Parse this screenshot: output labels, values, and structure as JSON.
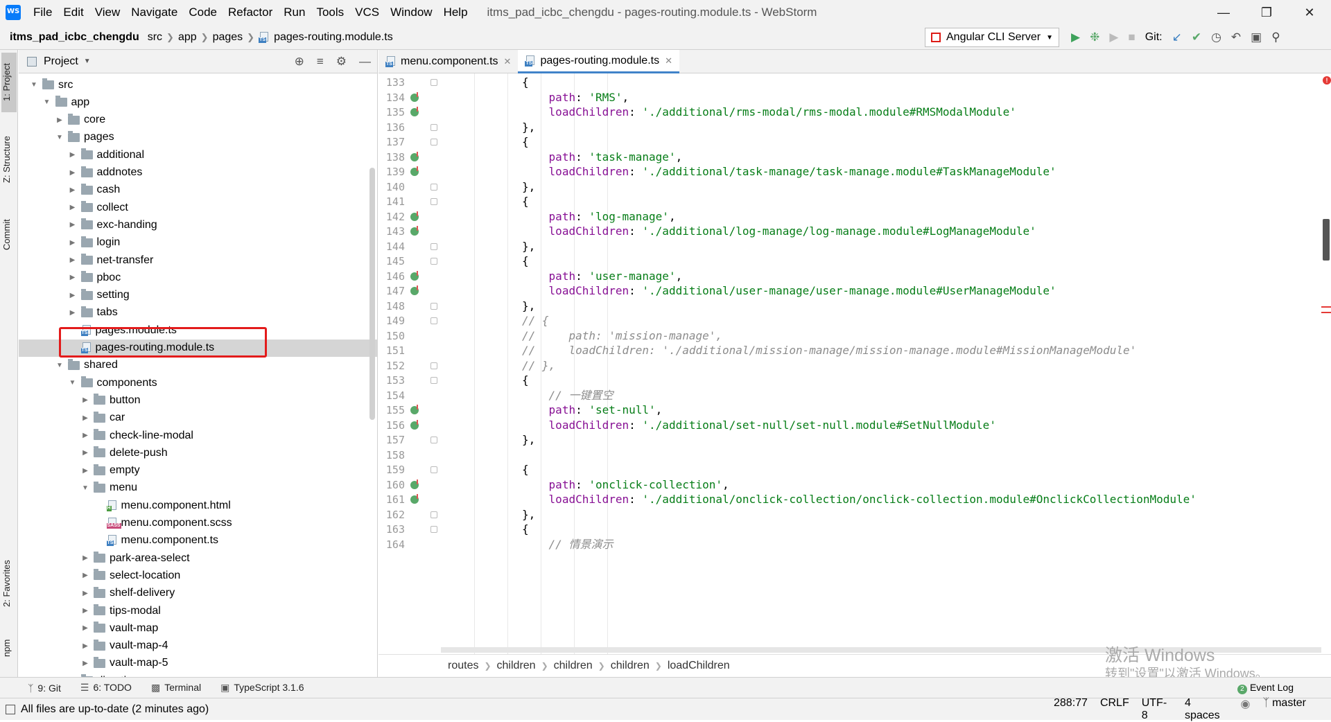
{
  "menubar": {
    "items": [
      "File",
      "Edit",
      "View",
      "Navigate",
      "Code",
      "Refactor",
      "Run",
      "Tools",
      "VCS",
      "Window",
      "Help"
    ],
    "title": "itms_pad_icbc_chengdu - pages-routing.module.ts - WebStorm"
  },
  "navbar": {
    "crumbs": [
      "itms_pad_icbc_chengdu",
      "src",
      "app",
      "pages",
      "pages-routing.module.ts"
    ],
    "run_config": "Angular CLI Server",
    "git_label": "Git:"
  },
  "left_stripe": {
    "project": "1: Project",
    "structure": "Z: Structure",
    "commit": "Commit",
    "favorites": "2: Favorites",
    "npm": "npm"
  },
  "project_panel": {
    "title": "Project",
    "tree": [
      {
        "label": "src",
        "depth": 0,
        "kind": "folder",
        "open": true
      },
      {
        "label": "app",
        "depth": 1,
        "kind": "folder",
        "open": true
      },
      {
        "label": "core",
        "depth": 2,
        "kind": "folder",
        "open": false
      },
      {
        "label": "pages",
        "depth": 2,
        "kind": "folder",
        "open": true
      },
      {
        "label": "additional",
        "depth": 3,
        "kind": "folder",
        "open": false
      },
      {
        "label": "addnotes",
        "depth": 3,
        "kind": "folder",
        "open": false
      },
      {
        "label": "cash",
        "depth": 3,
        "kind": "folder",
        "open": false
      },
      {
        "label": "collect",
        "depth": 3,
        "kind": "folder",
        "open": false
      },
      {
        "label": "exc-handing",
        "depth": 3,
        "kind": "folder",
        "open": false
      },
      {
        "label": "login",
        "depth": 3,
        "kind": "folder",
        "open": false
      },
      {
        "label": "net-transfer",
        "depth": 3,
        "kind": "folder",
        "open": false
      },
      {
        "label": "pboc",
        "depth": 3,
        "kind": "folder",
        "open": false
      },
      {
        "label": "setting",
        "depth": 3,
        "kind": "folder",
        "open": false
      },
      {
        "label": "tabs",
        "depth": 3,
        "kind": "folder",
        "open": false
      },
      {
        "label": "pages.module.ts",
        "depth": 3,
        "kind": "ts"
      },
      {
        "label": "pages-routing.module.ts",
        "depth": 3,
        "kind": "ts",
        "selected": true
      },
      {
        "label": "shared",
        "depth": 2,
        "kind": "folder",
        "open": true
      },
      {
        "label": "components",
        "depth": 3,
        "kind": "folder",
        "open": true
      },
      {
        "label": "button",
        "depth": 4,
        "kind": "folder",
        "open": false
      },
      {
        "label": "car",
        "depth": 4,
        "kind": "folder",
        "open": false
      },
      {
        "label": "check-line-modal",
        "depth": 4,
        "kind": "folder",
        "open": false
      },
      {
        "label": "delete-push",
        "depth": 4,
        "kind": "folder",
        "open": false
      },
      {
        "label": "empty",
        "depth": 4,
        "kind": "folder",
        "open": false
      },
      {
        "label": "menu",
        "depth": 4,
        "kind": "folder",
        "open": true
      },
      {
        "label": "menu.component.html",
        "depth": 5,
        "kind": "html"
      },
      {
        "label": "menu.component.scss",
        "depth": 5,
        "kind": "scss"
      },
      {
        "label": "menu.component.ts",
        "depth": 5,
        "kind": "ts"
      },
      {
        "label": "park-area-select",
        "depth": 4,
        "kind": "folder",
        "open": false
      },
      {
        "label": "select-location",
        "depth": 4,
        "kind": "folder",
        "open": false
      },
      {
        "label": "shelf-delivery",
        "depth": 4,
        "kind": "folder",
        "open": false
      },
      {
        "label": "tips-modal",
        "depth": 4,
        "kind": "folder",
        "open": false
      },
      {
        "label": "vault-map",
        "depth": 4,
        "kind": "folder",
        "open": false
      },
      {
        "label": "vault-map-4",
        "depth": 4,
        "kind": "folder",
        "open": false
      },
      {
        "label": "vault-map-5",
        "depth": 4,
        "kind": "folder",
        "open": false
      },
      {
        "label": "directives",
        "depth": 3,
        "kind": "folder",
        "open": false
      }
    ]
  },
  "editor": {
    "tabs": [
      {
        "label": "menu.component.ts",
        "active": false
      },
      {
        "label": "pages-routing.module.ts",
        "active": true
      }
    ],
    "lines": [
      {
        "n": "133",
        "marker": false,
        "fold": true,
        "parts": [
          [
            "p",
            "{"
          ]
        ],
        "indent": 2
      },
      {
        "n": "134",
        "marker": true,
        "fold": false,
        "parts": [
          [
            "k",
            "path"
          ],
          [
            "p",
            ": "
          ],
          [
            "s",
            "'RMS'"
          ],
          [
            "p",
            ","
          ]
        ],
        "indent": 3
      },
      {
        "n": "135",
        "marker": true,
        "fold": false,
        "parts": [
          [
            "k",
            "loadChildren"
          ],
          [
            "p",
            ": "
          ],
          [
            "s",
            "'./additional/rms-modal/rms-modal.module#RMSModalModule'"
          ]
        ],
        "indent": 3
      },
      {
        "n": "136",
        "marker": false,
        "fold": true,
        "parts": [
          [
            "p",
            "},"
          ]
        ],
        "indent": 2
      },
      {
        "n": "137",
        "marker": false,
        "fold": true,
        "parts": [
          [
            "p",
            "{"
          ]
        ],
        "indent": 2
      },
      {
        "n": "138",
        "marker": true,
        "fold": false,
        "parts": [
          [
            "k",
            "path"
          ],
          [
            "p",
            ": "
          ],
          [
            "s",
            "'task-manage'"
          ],
          [
            "p",
            ","
          ]
        ],
        "indent": 3
      },
      {
        "n": "139",
        "marker": true,
        "fold": false,
        "parts": [
          [
            "k",
            "loadChildren"
          ],
          [
            "p",
            ": "
          ],
          [
            "s",
            "'./additional/task-manage/task-manage.module#TaskManageModule'"
          ]
        ],
        "indent": 3
      },
      {
        "n": "140",
        "marker": false,
        "fold": true,
        "parts": [
          [
            "p",
            "},"
          ]
        ],
        "indent": 2
      },
      {
        "n": "141",
        "marker": false,
        "fold": true,
        "parts": [
          [
            "p",
            "{"
          ]
        ],
        "indent": 2
      },
      {
        "n": "142",
        "marker": true,
        "fold": false,
        "parts": [
          [
            "k",
            "path"
          ],
          [
            "p",
            ": "
          ],
          [
            "s",
            "'log-manage'"
          ],
          [
            "p",
            ","
          ]
        ],
        "indent": 3
      },
      {
        "n": "143",
        "marker": true,
        "fold": false,
        "parts": [
          [
            "k",
            "loadChildren"
          ],
          [
            "p",
            ": "
          ],
          [
            "s",
            "'./additional/log-manage/log-manage.module#LogManageModule'"
          ]
        ],
        "indent": 3
      },
      {
        "n": "144",
        "marker": false,
        "fold": true,
        "parts": [
          [
            "p",
            "},"
          ]
        ],
        "indent": 2
      },
      {
        "n": "145",
        "marker": false,
        "fold": true,
        "parts": [
          [
            "p",
            "{"
          ]
        ],
        "indent": 2
      },
      {
        "n": "146",
        "marker": true,
        "fold": false,
        "parts": [
          [
            "k",
            "path"
          ],
          [
            "p",
            ": "
          ],
          [
            "s",
            "'user-manage'"
          ],
          [
            "p",
            ","
          ]
        ],
        "indent": 3
      },
      {
        "n": "147",
        "marker": true,
        "fold": false,
        "parts": [
          [
            "k",
            "loadChildren"
          ],
          [
            "p",
            ": "
          ],
          [
            "s",
            "'./additional/user-manage/user-manage.module#UserManageModule'"
          ]
        ],
        "indent": 3
      },
      {
        "n": "148",
        "marker": false,
        "fold": true,
        "parts": [
          [
            "p",
            "},"
          ]
        ],
        "indent": 2
      },
      {
        "n": "149",
        "marker": false,
        "fold": true,
        "parts": [
          [
            "c",
            "// {"
          ]
        ],
        "indent": 2
      },
      {
        "n": "150",
        "marker": false,
        "fold": false,
        "parts": [
          [
            "c",
            "//     path: 'mission-manage',"
          ]
        ],
        "indent": 2
      },
      {
        "n": "151",
        "marker": false,
        "fold": false,
        "parts": [
          [
            "c",
            "//     loadChildren: './additional/mission-manage/mission-manage.module#MissionManageModule'"
          ]
        ],
        "indent": 2
      },
      {
        "n": "152",
        "marker": false,
        "fold": true,
        "parts": [
          [
            "c",
            "// },"
          ]
        ],
        "indent": 2
      },
      {
        "n": "153",
        "marker": false,
        "fold": true,
        "parts": [
          [
            "p",
            "{"
          ]
        ],
        "indent": 2
      },
      {
        "n": "154",
        "marker": false,
        "fold": false,
        "parts": [
          [
            "c",
            "// 一键置空"
          ]
        ],
        "indent": 3
      },
      {
        "n": "155",
        "marker": true,
        "fold": false,
        "parts": [
          [
            "k",
            "path"
          ],
          [
            "p",
            ": "
          ],
          [
            "s",
            "'set-null'"
          ],
          [
            "p",
            ","
          ]
        ],
        "indent": 3
      },
      {
        "n": "156",
        "marker": true,
        "fold": false,
        "parts": [
          [
            "k",
            "loadChildren"
          ],
          [
            "p",
            ": "
          ],
          [
            "s",
            "'./additional/set-null/set-null.module#SetNullModule'"
          ]
        ],
        "indent": 3
      },
      {
        "n": "157",
        "marker": false,
        "fold": true,
        "parts": [
          [
            "p",
            "},"
          ]
        ],
        "indent": 2
      },
      {
        "n": "158",
        "marker": false,
        "fold": false,
        "parts": [],
        "indent": 2
      },
      {
        "n": "159",
        "marker": false,
        "fold": true,
        "parts": [
          [
            "p",
            "{"
          ]
        ],
        "indent": 2
      },
      {
        "n": "160",
        "marker": true,
        "fold": false,
        "parts": [
          [
            "k",
            "path"
          ],
          [
            "p",
            ": "
          ],
          [
            "s",
            "'onclick-collection'"
          ],
          [
            "p",
            ","
          ]
        ],
        "indent": 3
      },
      {
        "n": "161",
        "marker": true,
        "fold": false,
        "parts": [
          [
            "k",
            "loadChildren"
          ],
          [
            "p",
            ": "
          ],
          [
            "s",
            "'./additional/onclick-collection/onclick-collection.module#OnclickCollectionModule'"
          ]
        ],
        "indent": 3
      },
      {
        "n": "162",
        "marker": false,
        "fold": true,
        "parts": [
          [
            "p",
            "},"
          ]
        ],
        "indent": 2
      },
      {
        "n": "163",
        "marker": false,
        "fold": true,
        "parts": [
          [
            "p",
            "{"
          ]
        ],
        "indent": 2
      },
      {
        "n": "164",
        "marker": false,
        "fold": false,
        "parts": [
          [
            "c",
            "// 情景演示"
          ]
        ],
        "indent": 3
      }
    ],
    "breadcrumbs": [
      "routes",
      "children",
      "children",
      "children",
      "loadChildren"
    ]
  },
  "watermark": {
    "line1": "激活 Windows",
    "line2": "转到\"设置\"以激活 Windows。"
  },
  "toolwindows": {
    "git": "9: Git",
    "todo": "6: TODO",
    "terminal": "Terminal",
    "typescript": "TypeScript 3.1.6",
    "event_log_count": "2",
    "event_log": "Event Log"
  },
  "statusbar": {
    "message": "All files are up-to-date (2 minutes ago)",
    "position": "288:77",
    "line_sep": "CRLF",
    "encoding": "UTF-8",
    "indent": "4 spaces",
    "branch": "master"
  },
  "colors": {
    "keyword": "#871094",
    "string": "#067d17",
    "comment": "#8c8c8c",
    "accent": "#4083c9",
    "highlight_box": "#e31b1b"
  }
}
